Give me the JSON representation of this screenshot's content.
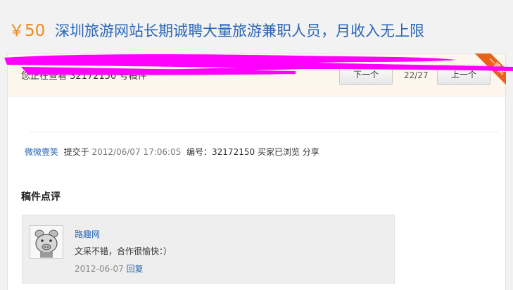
{
  "header": {
    "price": "￥50",
    "title": "深圳旅游网站长期诚聘大量旅游兼职人员，月收入无上限"
  },
  "viewbar": {
    "viewing_prefix": "您正在查看",
    "manuscript_id": "32172150",
    "viewing_suffix": "号稿件",
    "next_label": "下一个",
    "counter": "22/27",
    "prev_label": "上一个",
    "award_ribbon": "一等奖"
  },
  "meta": {
    "author": "微微壹笑",
    "submitted_label": "提交于",
    "submitted_time": "2012/06/07 17:06:05",
    "number_label": "编号：",
    "number": "32172150",
    "status": "买家已浏览",
    "share_label": "分享"
  },
  "review": {
    "heading": "稿件点评",
    "reviewer": "路趣网",
    "text": "文采不错，合作很愉快：）",
    "date": "2012-06-07",
    "reply_label": "回复"
  },
  "colors": {
    "price": "#f08a1c",
    "title_link": "#2a66b8",
    "ribbon": "#e8621c",
    "redaction": "#ff00ff",
    "viewbar_bg": "#fdf6ec"
  }
}
